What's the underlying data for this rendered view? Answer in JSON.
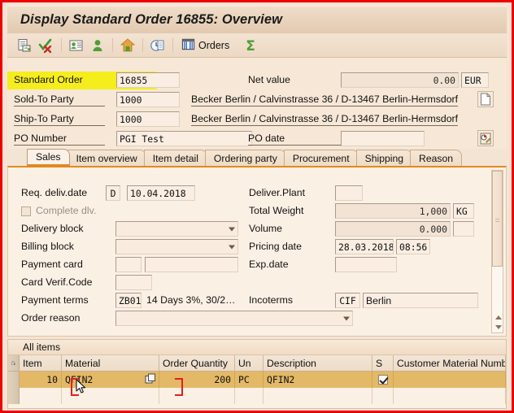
{
  "window": {
    "title": "Display Standard Order 16855: Overview"
  },
  "toolbar": {
    "buttons": [
      {
        "name": "display-document-icon",
        "label": "",
        "glyph": "document-with-arrow-icon"
      },
      {
        "name": "check-cancel-icon",
        "label": "",
        "glyph": "check-red-x-icon"
      },
      {
        "name": "partner-card-icon",
        "label": "",
        "glyph": "business-card-icon"
      },
      {
        "name": "person-icon",
        "label": "",
        "glyph": "person-icon"
      },
      {
        "name": "home-icon",
        "label": "",
        "glyph": "house-icon"
      },
      {
        "name": "availability-icon",
        "label": "",
        "glyph": "clock-document-icon"
      }
    ],
    "orders_label": "Orders",
    "sum_label": "Σ"
  },
  "header": {
    "order_type_label": "Standard Order",
    "order_number": "16855",
    "net_value_label": "Net value",
    "net_value": "0.00",
    "currency": "EUR",
    "sold_to_label": "Sold-To Party",
    "sold_to_value": "1000",
    "sold_to_desc": "Becker Berlin / Calvinstrasse 36 / D-13467 Berlin-Hermsdorf",
    "ship_to_label": "Ship-To Party",
    "ship_to_value": "1000",
    "ship_to_desc": "Becker Berlin / Calvinstrasse 36 / D-13467 Berlin-Hermsdorf",
    "po_number_label": "PO Number",
    "po_number_value": "PGI Test",
    "po_date_label": "PO date",
    "po_date_value": "",
    "highlight_color": "#f5ee1c"
  },
  "tabs": [
    {
      "label": "Sales",
      "active": true
    },
    {
      "label": "Item overview",
      "active": false
    },
    {
      "label": "Item detail",
      "active": false
    },
    {
      "label": "Ordering party",
      "active": false
    },
    {
      "label": "Procurement",
      "active": false
    },
    {
      "label": "Shipping",
      "active": false
    },
    {
      "label": "Reason",
      "active": false
    }
  ],
  "sales_tab": {
    "req_deliv_date_label": "Req. deliv.date",
    "req_deliv_date_type": "D",
    "req_deliv_date_value": "10.04.2018",
    "complete_dlv_label": "Complete dlv.",
    "complete_dlv_checked": false,
    "delivery_block_label": "Delivery block",
    "delivery_block_value": "",
    "billing_block_label": "Billing block",
    "billing_block_value": "",
    "payment_card_label": "Payment card",
    "payment_card_value": "",
    "payment_card_value2": "",
    "card_verif_code_label": "Card Verif.Code",
    "card_verif_code_value": "",
    "payment_terms_label": "Payment terms",
    "payment_terms_key": "ZB01",
    "payment_terms_text": "14 Days 3%, 30/2…",
    "order_reason_label": "Order reason",
    "order_reason_value": "",
    "deliver_plant_label": "Deliver.Plant",
    "deliver_plant_value": "",
    "total_weight_label": "Total Weight",
    "total_weight_value": "1,000",
    "total_weight_unit": "KG",
    "volume_label": "Volume",
    "volume_value": "0.000",
    "volume_unit": "",
    "pricing_date_label": "Pricing date",
    "pricing_date_value": "28.03.2018",
    "pricing_time_value": "08:56",
    "exp_date_label": "Exp.date",
    "exp_date_value": "",
    "incoterms_label": "Incoterms",
    "incoterms_key": "CIF",
    "incoterms_text": "Berlin"
  },
  "all_items": {
    "panel_label": "All items",
    "columns": [
      "Item",
      "Material",
      "Order Quantity",
      "Un",
      "Description",
      "S",
      "Customer Material Numb"
    ],
    "rows": [
      {
        "item": "10",
        "material": "QFIN2",
        "order_quantity": "200",
        "unit": "PC",
        "description": "QFIN2",
        "s_checked": true,
        "customer_material_number": ""
      }
    ]
  },
  "annotation": {
    "color": "#e02020",
    "target": "material-cell"
  }
}
